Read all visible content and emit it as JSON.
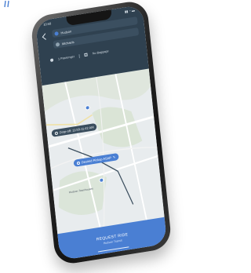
{
  "status": {
    "time": "10:58",
    "right": "▮▮ ◔ ▬"
  },
  "fields": {
    "pickup": {
      "label": "Hudson",
      "color": "#4a7fd3"
    },
    "dropoff": {
      "label": "Michaels",
      "color": "#8fa2b0"
    }
  },
  "options": {
    "passengers": "1 Passenger",
    "bags": "No Baggage"
  },
  "map": {
    "dropoff_chip": "Drop-off: 11:59-11:42 AM",
    "pickup_chip": "Desired Pickup ASAP",
    "place_label": "Hudson Townhouses"
  },
  "cta": {
    "label": "REQUEST RIDE",
    "sublabel": "Hudson Transit"
  },
  "colors": {
    "panel": "#2f4150",
    "accent": "#4a7fd3",
    "map": "#e8ecee"
  }
}
